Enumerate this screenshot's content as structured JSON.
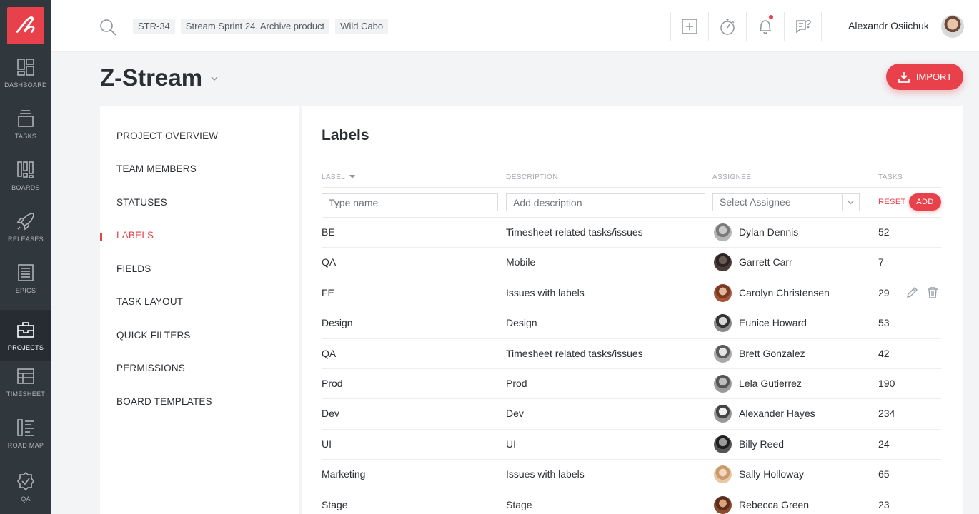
{
  "app": {
    "brand_color": "#e8414b"
  },
  "rail": [
    {
      "label": "DASHBOARD",
      "icon": "dashboard-icon"
    },
    {
      "label": "TASKS",
      "icon": "tasks-icon"
    },
    {
      "label": "BOARDS",
      "icon": "boards-icon"
    },
    {
      "label": "RELEASES",
      "icon": "rocket-icon"
    },
    {
      "label": "EPICS",
      "icon": "epics-icon"
    },
    {
      "label": "PROJECTS",
      "icon": "briefcase-icon",
      "active": true
    },
    {
      "label": "TIMESHEET",
      "icon": "timesheet-icon"
    },
    {
      "label": "ROAD MAP",
      "icon": "roadmap-icon"
    },
    {
      "label": "QA",
      "icon": "qa-badge-icon"
    }
  ],
  "topbar": {
    "crumbs": [
      "STR-34",
      "Stream Sprint 24. Archive product",
      "Wild Cabo"
    ],
    "user_name": "Alexandr Osiichuk"
  },
  "project": {
    "title": "Z-Stream",
    "import_label": "IMPORT"
  },
  "settings_nav": [
    {
      "label": "PROJECT OVERVIEW"
    },
    {
      "label": "TEAM MEMBERS"
    },
    {
      "label": "STATUSES"
    },
    {
      "label": "LABELS",
      "active": true
    },
    {
      "label": "FIELDS"
    },
    {
      "label": "TASK LAYOUT"
    },
    {
      "label": "QUICK FILTERS"
    },
    {
      "label": "PERMISSIONS"
    },
    {
      "label": "BOARD TEMPLATES"
    }
  ],
  "labels": {
    "title": "Labels",
    "columns": {
      "label": "LABEL",
      "description": "DESCRIPTION",
      "assignee": "ASSIGNEE",
      "tasks": "TASKS"
    },
    "add_form": {
      "name_placeholder": "Type name",
      "desc_placeholder": "Add description",
      "assignee_placeholder": "Select Assignee",
      "reset_label": "RESET",
      "add_label": "ADD"
    },
    "rows": [
      {
        "label": "BE",
        "description": "Timesheet related tasks/issues",
        "assignee": "Dylan Dennis",
        "tasks": "52"
      },
      {
        "label": "QA",
        "description": "Mobile",
        "assignee": "Garrett Carr",
        "tasks": "7"
      },
      {
        "label": "FE",
        "description": "Issues with labels",
        "assignee": "Carolyn Christensen",
        "tasks": "29",
        "hover": true
      },
      {
        "label": "Design",
        "description": "Design",
        "assignee": "Eunice Howard",
        "tasks": "53"
      },
      {
        "label": "QA",
        "description": "Timesheet related tasks/issues",
        "assignee": "Brett Gonzalez",
        "tasks": "42"
      },
      {
        "label": "Prod",
        "description": "Prod",
        "assignee": "Lela Gutierrez",
        "tasks": "190"
      },
      {
        "label": "Dev",
        "description": "Dev",
        "assignee": "Alexander Hayes",
        "tasks": "234"
      },
      {
        "label": "UI",
        "description": "UI",
        "assignee": "Billy Reed",
        "tasks": "24"
      },
      {
        "label": "Marketing",
        "description": "Issues with labels",
        "assignee": "Sally Holloway",
        "tasks": "65"
      },
      {
        "label": "Stage",
        "description": "Stage",
        "assignee": "Rebecca Green",
        "tasks": "23"
      }
    ]
  }
}
